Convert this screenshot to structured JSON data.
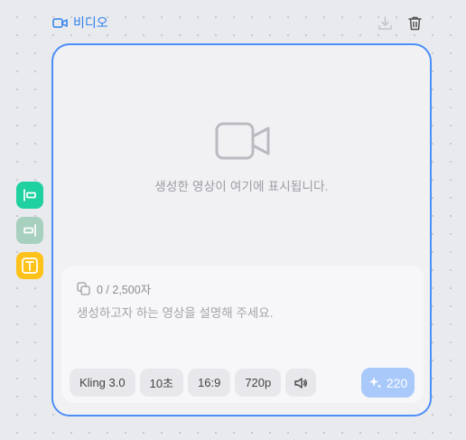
{
  "node": {
    "title": "비디오",
    "title_icon": "video-camera-icon",
    "actions": [
      {
        "name": "download",
        "icon": "download-icon"
      },
      {
        "name": "delete",
        "icon": "trash-icon"
      }
    ]
  },
  "preview": {
    "icon": "video-camera-icon",
    "empty_text": "생성한 영상이 여기에 표시됩니다."
  },
  "prompt": {
    "char_count": "0 / 2,500자",
    "copy_icon": "copy-icon",
    "placeholder": "생성하고자 하는 영상을 설명해 주세요.",
    "value": ""
  },
  "options": {
    "model": "Kling 3.0",
    "duration": "10초",
    "aspect_ratio": "16:9",
    "resolution": "720p",
    "sound_icon": "speaker-icon"
  },
  "generate": {
    "icon": "sparkle-icon",
    "credits": "220"
  },
  "side_tools": [
    {
      "name": "align-left",
      "icon": "align-left-icon",
      "color": "#1fd1a0"
    },
    {
      "name": "align-right",
      "icon": "align-right-icon",
      "color": "#a7d1be"
    },
    {
      "name": "text",
      "icon": "text-icon",
      "color": "#ffc21a"
    }
  ],
  "colors": {
    "accent": "#4b8ff7",
    "title": "#2f80ed",
    "generate_disabled": "#a9c9fb"
  }
}
